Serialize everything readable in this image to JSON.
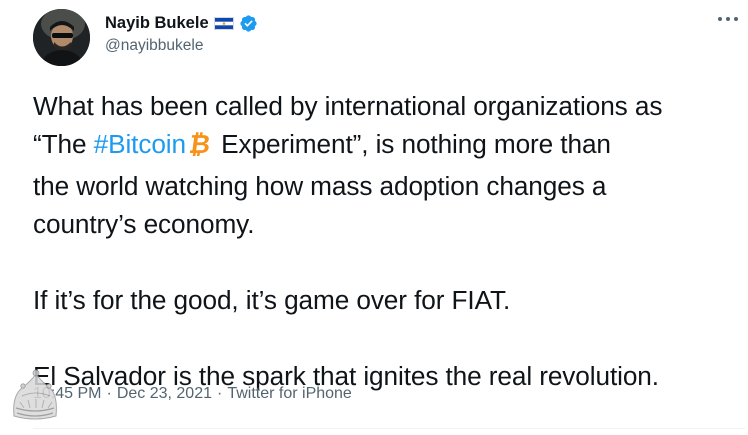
{
  "author": {
    "display_name": "Nayib Bukele",
    "handle": "@nayibbukele",
    "flag_icon": "el-salvador-flag-icon",
    "verified_icon": "verified-badge-icon"
  },
  "menu": {
    "icon": "more-horizontal-icon"
  },
  "tweet": {
    "line1_prefix": "What has been called by international organizations as",
    "line2_open_quote": "“The ",
    "hashtag": "#Bitcoin",
    "line2_suffix": " Experiment”, is nothing more than",
    "line3": "the world watching how mass adoption changes a",
    "line4": "country’s economy.",
    "paragraph2": "If it’s for the good, it’s game over for FIAT.",
    "paragraph3": "El Salvador is the spark that ignites the real revolution."
  },
  "meta": {
    "time": "10:45 PM",
    "separator": "·",
    "date": "Dec 23, 2021",
    "source": "Twitter for iPhone"
  },
  "colors": {
    "text": "#0f1419",
    "secondary": "#536471",
    "link": "#1d9bf0",
    "bitcoin": "#f7931a",
    "verified": "#1d9bf0"
  }
}
